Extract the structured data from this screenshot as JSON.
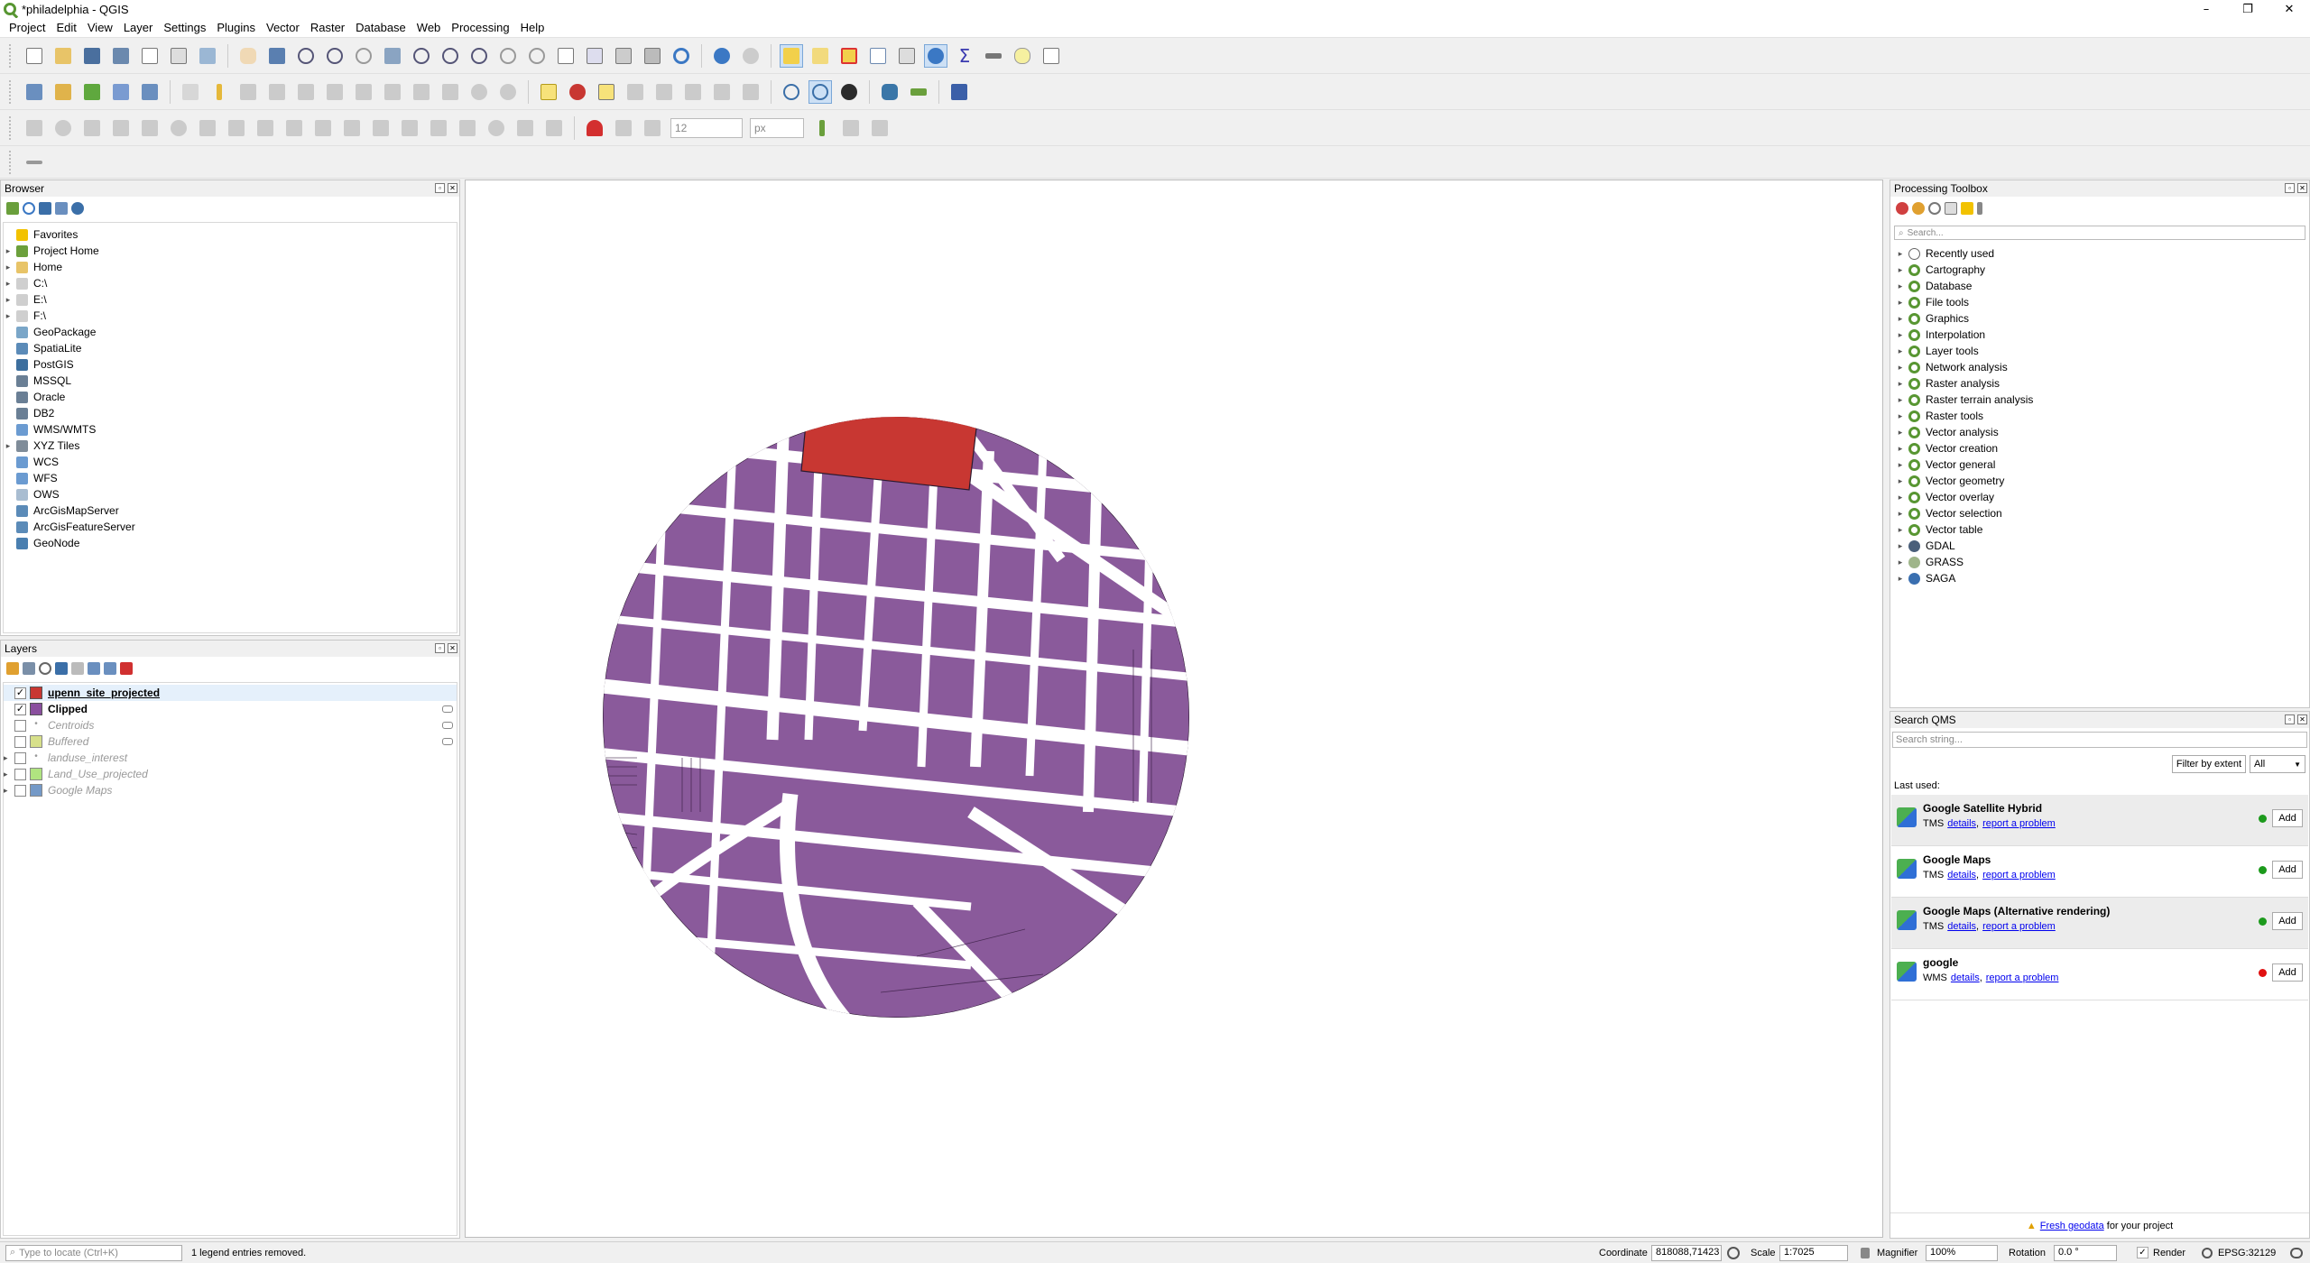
{
  "window": {
    "title": "*philadelphia - QGIS",
    "minimize": "–",
    "maximize": "❐",
    "close": "✕"
  },
  "menu": [
    "Project",
    "Edit",
    "View",
    "Layer",
    "Settings",
    "Plugins",
    "Vector",
    "Raster",
    "Database",
    "Web",
    "Processing",
    "Help"
  ],
  "toolbar": {
    "snap_tolerance": "12",
    "snap_unit": "px"
  },
  "browser": {
    "title": "Browser",
    "items": [
      {
        "label": "Favorites",
        "icon": "star-icon",
        "color": "#f2c200",
        "arrow": ""
      },
      {
        "label": "Project Home",
        "icon": "project-home-icon",
        "color": "#6ca03c",
        "arrow": "▸"
      },
      {
        "label": "Home",
        "icon": "home-folder-icon",
        "color": "#e8c468",
        "arrow": "▸"
      },
      {
        "label": "C:\\",
        "icon": "drive-icon",
        "color": "#cfcfcf",
        "arrow": "▸"
      },
      {
        "label": "E:\\",
        "icon": "drive-icon",
        "color": "#cfcfcf",
        "arrow": "▸"
      },
      {
        "label": "F:\\",
        "icon": "drive-icon",
        "color": "#cfcfcf",
        "arrow": "▸"
      },
      {
        "label": "GeoPackage",
        "icon": "geopackage-icon",
        "color": "#7aa6c8",
        "arrow": ""
      },
      {
        "label": "SpatiaLite",
        "icon": "spatialite-icon",
        "color": "#5b8bb8",
        "arrow": ""
      },
      {
        "label": "PostGIS",
        "icon": "postgis-icon",
        "color": "#3d6f9e",
        "arrow": ""
      },
      {
        "label": "MSSQL",
        "icon": "mssql-icon",
        "color": "#6a7f95",
        "arrow": ""
      },
      {
        "label": "Oracle",
        "icon": "oracle-icon",
        "color": "#6a7f95",
        "arrow": ""
      },
      {
        "label": "DB2",
        "icon": "db2-icon",
        "color": "#6a7f95",
        "arrow": ""
      },
      {
        "label": "WMS/WMTS",
        "icon": "wms-icon",
        "color": "#6b9bd1",
        "arrow": ""
      },
      {
        "label": "XYZ Tiles",
        "icon": "xyz-tiles-icon",
        "color": "#7f8c99",
        "arrow": "▸"
      },
      {
        "label": "WCS",
        "icon": "wcs-icon",
        "color": "#6b9bd1",
        "arrow": ""
      },
      {
        "label": "WFS",
        "icon": "wfs-icon",
        "color": "#6b9bd1",
        "arrow": ""
      },
      {
        "label": "OWS",
        "icon": "ows-icon",
        "color": "#a9bdd1",
        "arrow": ""
      },
      {
        "label": "ArcGisMapServer",
        "icon": "arcgis-map-icon",
        "color": "#5b8bb8",
        "arrow": ""
      },
      {
        "label": "ArcGisFeatureServer",
        "icon": "arcgis-feature-icon",
        "color": "#5b8bb8",
        "arrow": ""
      },
      {
        "label": "GeoNode",
        "icon": "geonode-icon",
        "color": "#4a7fb0",
        "arrow": ""
      }
    ]
  },
  "layers": {
    "title": "Layers",
    "items": [
      {
        "label": "upenn_site_projected",
        "checked": true,
        "color": "#c83732",
        "style": "bold-underline"
      },
      {
        "label": "Clipped",
        "checked": true,
        "color": "#8a4f9e",
        "style": "bold"
      },
      {
        "label": "Centroids",
        "checked": false,
        "color": "",
        "style": "off"
      },
      {
        "label": "Buffered",
        "checked": false,
        "color": "#c7d45a",
        "style": "off"
      },
      {
        "label": "landuse_interest",
        "checked": false,
        "color": "",
        "style": "off"
      },
      {
        "label": "Land_Use_projected",
        "checked": false,
        "color": "#8fd94b",
        "style": "off"
      },
      {
        "label": "Google Maps",
        "checked": false,
        "color": "#3a6fb0",
        "style": "off"
      }
    ]
  },
  "processing": {
    "title": "Processing Toolbox",
    "search_placeholder": "Search...",
    "items": [
      "Recently used",
      "Cartography",
      "Database",
      "File tools",
      "Graphics",
      "Interpolation",
      "Layer tools",
      "Network analysis",
      "Raster analysis",
      "Raster terrain analysis",
      "Raster tools",
      "Vector analysis",
      "Vector creation",
      "Vector general",
      "Vector geometry",
      "Vector overlay",
      "Vector selection",
      "Vector table",
      "GDAL",
      "GRASS",
      "SAGA"
    ]
  },
  "qms": {
    "title": "Search QMS",
    "search_placeholder": "Search string...",
    "filter_button": "Filter by extent",
    "filter_value": "All",
    "last_used_label": "Last used:",
    "items": [
      {
        "name": "Google Satellite Hybrid",
        "type": "TMS",
        "details": "details",
        "report": "report a problem",
        "status": "#1c9a1c",
        "add": "Add"
      },
      {
        "name": "Google Maps",
        "type": "TMS",
        "details": "details",
        "report": "report a problem",
        "status": "#1c9a1c",
        "add": "Add"
      },
      {
        "name": "Google Maps (Alternative rendering)",
        "type": "TMS",
        "details": "details",
        "report": "report a problem",
        "status": "#1c9a1c",
        "add": "Add"
      },
      {
        "name": "google",
        "type": "WMS",
        "details": "details",
        "report": "report a problem",
        "status": "#e01010",
        "add": "Add"
      }
    ],
    "footer_link": "Fresh geodata",
    "footer_text": " for your project"
  },
  "status": {
    "locate_placeholder": "Type to locate (Ctrl+K)",
    "message": "1 legend entries removed.",
    "coordinate_label": "Coordinate",
    "coordinate": "818088,71423",
    "scale_label": "Scale",
    "scale": "1:7025",
    "magnifier_label": "Magnifier",
    "magnifier": "100%",
    "rotation_label": "Rotation",
    "rotation": "0.0 °",
    "render_label": "Render",
    "crs": "EPSG:32129"
  },
  "map": {
    "parcel_color": "#8a5a9b",
    "site_color": "#c83732",
    "street_color": "#ffffff"
  }
}
